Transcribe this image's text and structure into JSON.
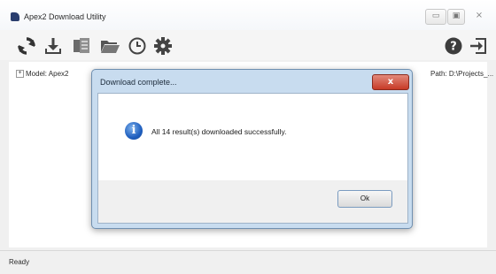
{
  "window": {
    "title": "Apex2 Download Utility",
    "controls": {
      "minimize": "▭",
      "maximize": "▣",
      "close": "⨯"
    }
  },
  "toolbar": {
    "icons": [
      "refresh-icon",
      "download-icon",
      "export-icon",
      "folder-open-icon",
      "history-clock-icon",
      "settings-gear-icon",
      "help-icon",
      "exit-icon"
    ]
  },
  "tree": {
    "toggle": "+",
    "root_label": "Model: Apex2"
  },
  "path_label": "Path: D:\\Projects_...",
  "status": {
    "text": "Ready"
  },
  "dialog": {
    "title": "Download complete...",
    "close_label": "x",
    "icon_glyph": "i",
    "message": "All 14 result(s) downloaded successfully.",
    "ok_label": "Ok"
  },
  "colors": {
    "dialog_frame": "#c8dcef",
    "close_button": "#c73a26",
    "info_icon": "#1f5fbf"
  }
}
